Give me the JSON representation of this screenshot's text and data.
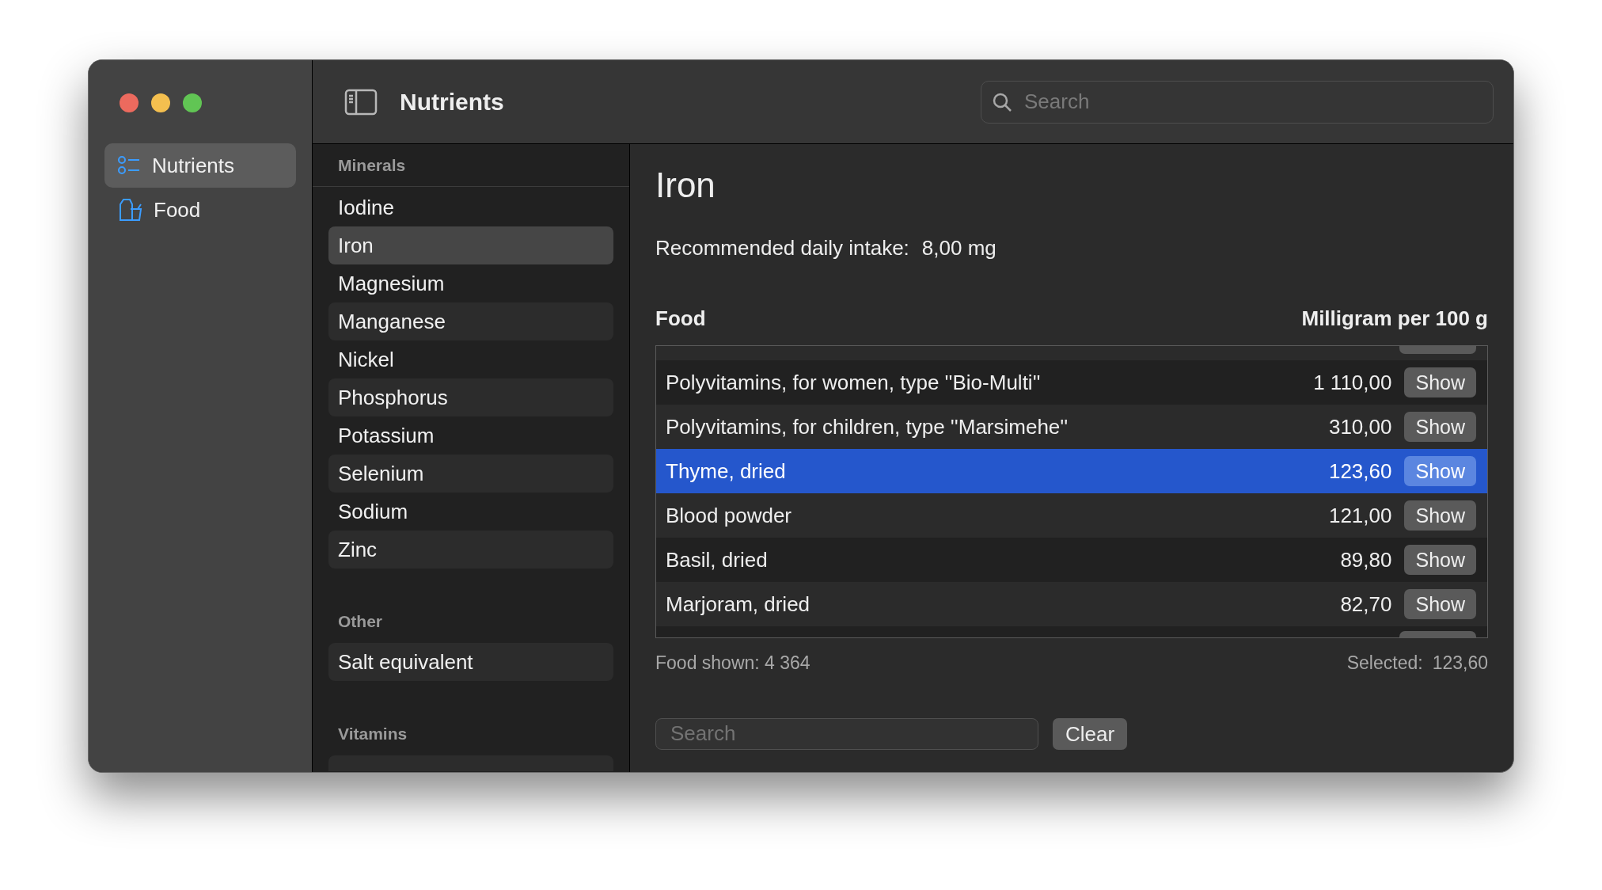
{
  "window": {
    "title": "Nutrients"
  },
  "sidebar": {
    "items": [
      {
        "label": "Nutrients",
        "selected": true
      },
      {
        "label": "Food",
        "selected": false
      }
    ]
  },
  "toolbar": {
    "search": {
      "placeholder": "Search"
    }
  },
  "groups": [
    {
      "title": "Minerals",
      "items": [
        {
          "label": "Iodine",
          "selected": false
        },
        {
          "label": "Iron",
          "selected": true
        },
        {
          "label": "Magnesium",
          "selected": false
        },
        {
          "label": "Manganese",
          "selected": false
        },
        {
          "label": "Nickel",
          "selected": false
        },
        {
          "label": "Phosphorus",
          "selected": false
        },
        {
          "label": "Potassium",
          "selected": false
        },
        {
          "label": "Selenium",
          "selected": false
        },
        {
          "label": "Sodium",
          "selected": false
        },
        {
          "label": "Zinc",
          "selected": false
        }
      ]
    },
    {
      "title": "Other",
      "items": [
        {
          "label": "Salt equivalent",
          "selected": false
        }
      ]
    },
    {
      "title": "Vitamins"
    }
  ],
  "detail": {
    "title": "Iron",
    "intake_label": "Recommended daily intake:",
    "intake_value": "8,00 mg",
    "table": {
      "columns": [
        "Food",
        "Milligram per 100 g"
      ],
      "rows": [
        {
          "food": "Polyvitamins, for women, type ''Bio-Multi''",
          "value": "1 110,00",
          "button": "Show",
          "selected": false
        },
        {
          "food": "Polyvitamins, for children, type ''Marsimehe''",
          "value": "310,00",
          "button": "Show",
          "selected": false
        },
        {
          "food": "Thyme, dried",
          "value": "123,60",
          "button": "Show",
          "selected": true
        },
        {
          "food": "Blood powder",
          "value": "121,00",
          "button": "Show",
          "selected": false
        },
        {
          "food": "Basil, dried",
          "value": "89,80",
          "button": "Show",
          "selected": false
        },
        {
          "food": "Marjoram, dried",
          "value": "82,70",
          "button": "Show",
          "selected": false
        }
      ]
    },
    "shown": "Food shown: 4 364",
    "selected_label": "Selected:",
    "selected_value": "123,60",
    "filter": {
      "placeholder": "Search",
      "button": "Clear"
    }
  }
}
